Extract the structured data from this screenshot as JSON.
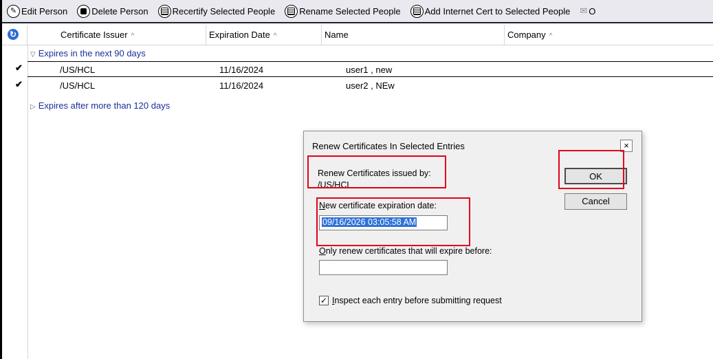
{
  "toolbar": {
    "edit_person": "Edit Person",
    "delete_person": "Delete Person",
    "recertify": "Recertify Selected People",
    "rename": "Rename Selected People",
    "add_internet_cert": "Add Internet Cert to Selected People",
    "overflow": "O"
  },
  "columns": {
    "issuer": "Certificate Issuer",
    "expiration": "Expiration Date",
    "name": "Name",
    "company": "Company",
    "sort_glyph": "^"
  },
  "categories": {
    "soon": "Expires in the next 90 days",
    "later": "Expires after more than 120 days"
  },
  "rows": [
    {
      "check": "✔",
      "issuer": "/US/HCL",
      "expiration": "11/16/2024",
      "name": "user1 , new"
    },
    {
      "check": "✔",
      "issuer": "/US/HCL",
      "expiration": "11/16/2024",
      "name": "user2 , NEw"
    }
  ],
  "dialog": {
    "title": "Renew Certificates In Selected Entries",
    "issued_by_label": "Renew Certificates issued by:",
    "issued_by_value": "/US/HCL",
    "new_exp_label_underlined": "N",
    "new_exp_label_rest": "ew certificate expiration date:",
    "new_exp_value": "09/16/2026 03:05:58 AM",
    "only_renew_label_underlined": "O",
    "only_renew_label_rest": "nly renew certificates that will expire before:",
    "only_renew_value": "",
    "inspect_label_underlined": "I",
    "inspect_label_rest": "nspect each entry before submitting request",
    "inspect_checked": true,
    "ok": "OK",
    "cancel": "Cancel",
    "close_glyph": "×"
  },
  "colors": {
    "highlight": "#e3001b",
    "category_text": "#1d2f9a",
    "selection": "#3172d8"
  }
}
